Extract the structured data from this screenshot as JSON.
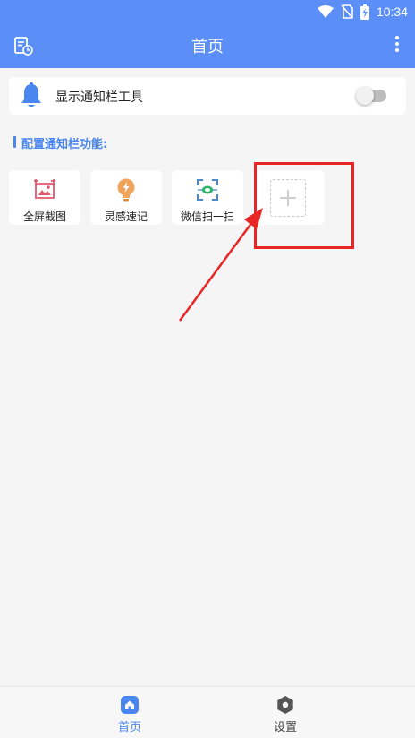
{
  "status_bar": {
    "time": "10:34",
    "icons": [
      "wifi-icon",
      "no-sim-icon",
      "battery-charging-icon"
    ]
  },
  "app_bar": {
    "title": "首页",
    "left_icon": "document-clock-icon",
    "right_icon": "more-vertical-icon"
  },
  "notification_toggle": {
    "icon": "bell-icon",
    "label": "显示通知栏工具",
    "enabled": false
  },
  "section": {
    "title": "配置通知栏功能:"
  },
  "tiles": [
    {
      "label": "全屏截图",
      "icon": "screenshot-icon",
      "color": "#e05a6e"
    },
    {
      "label": "灵感速记",
      "icon": "lightbulb-icon",
      "color": "#f0a35a"
    },
    {
      "label": "微信扫一扫",
      "icon": "wechat-scan-icon",
      "color": "#2bb56a"
    }
  ],
  "add_tile": {
    "icon": "plus-icon"
  },
  "bottom_nav": [
    {
      "label": "首页",
      "icon": "home-icon",
      "active": true
    },
    {
      "label": "设置",
      "icon": "settings-hex-icon",
      "active": false
    }
  ],
  "colors": {
    "primary": "#5b8ef6",
    "accent_text": "#4a86f0",
    "annotation": "#e82626",
    "background": "#f5f5f5"
  }
}
